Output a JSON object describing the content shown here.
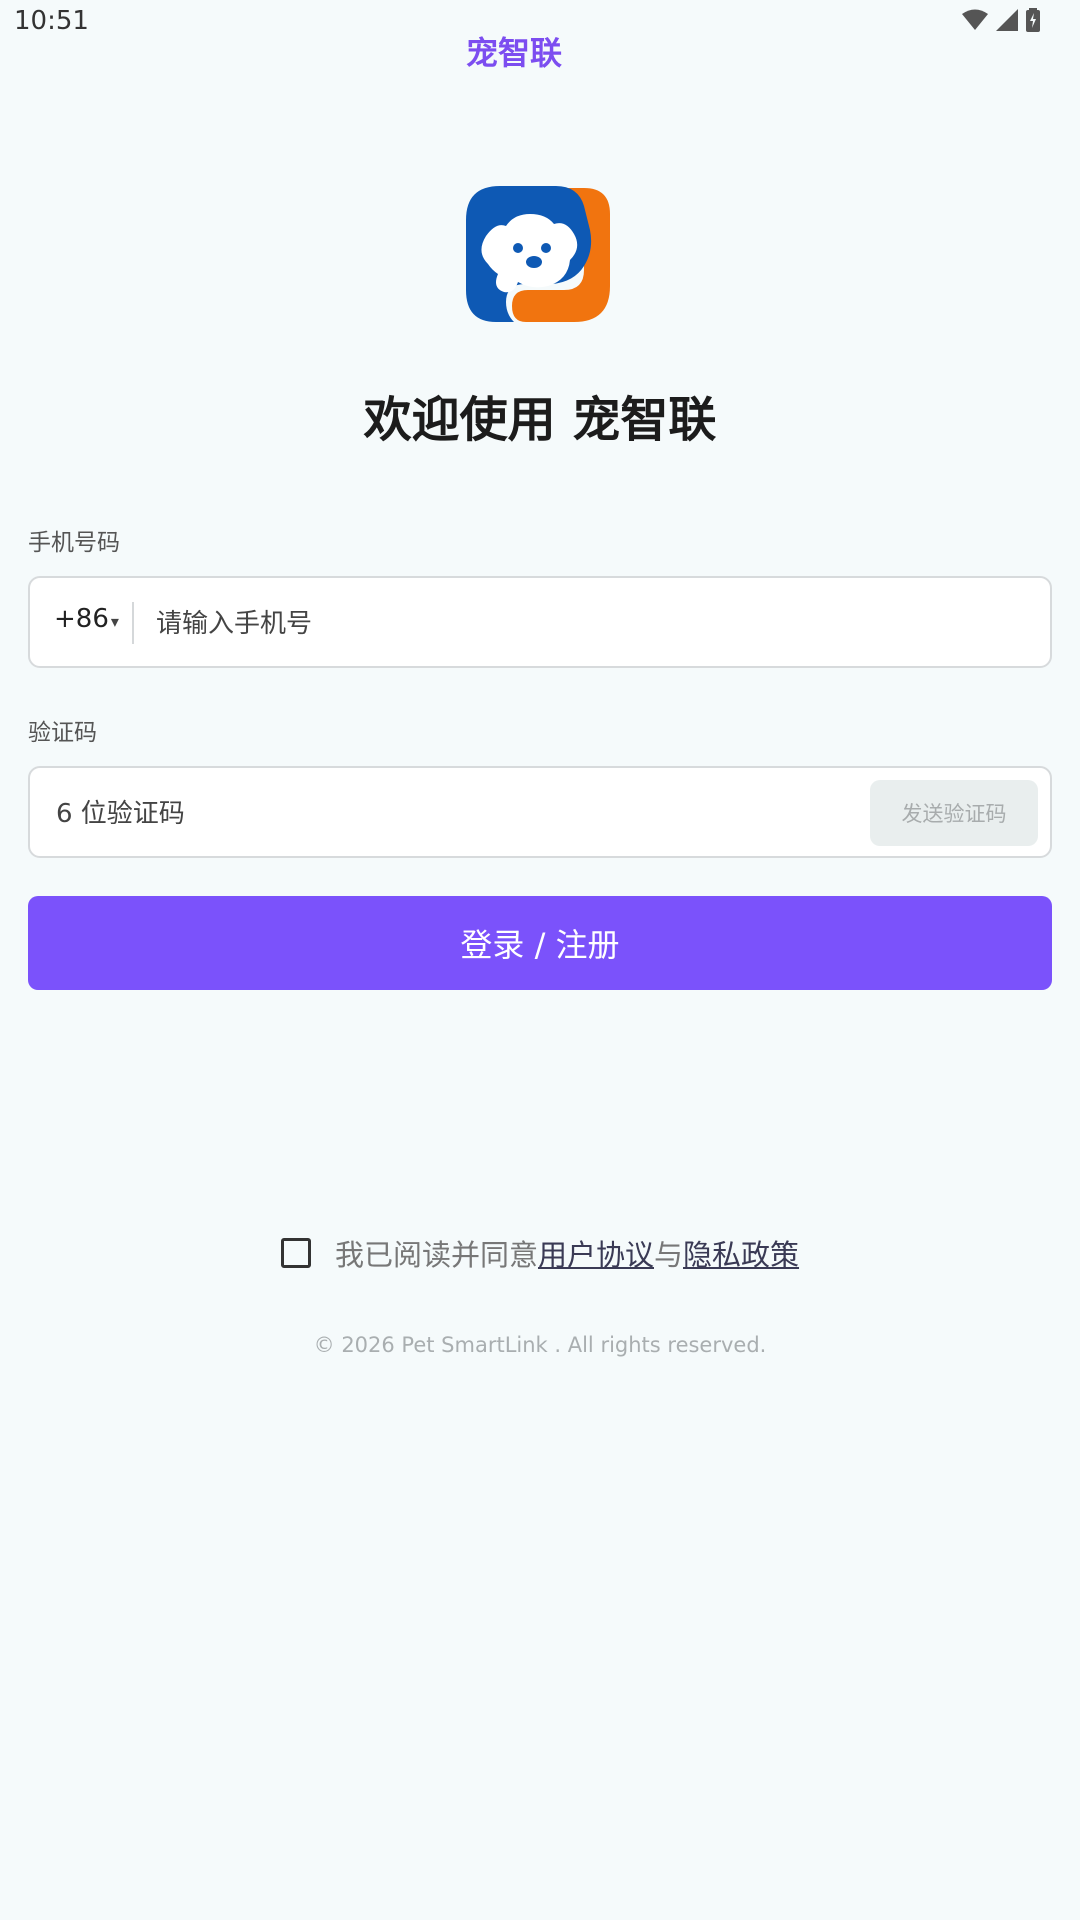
{
  "status_bar": {
    "time": "10:51"
  },
  "app_bar": {
    "title": "宠智联",
    "title_color": "#7c4df0"
  },
  "logo": {
    "icon": "dog-face-logo-icon",
    "colors": {
      "blue": "#0e59b4",
      "orange": "#f1740f"
    }
  },
  "welcome": "欢迎使用 宠智联",
  "phone": {
    "label": "手机号码",
    "country_code": "+86",
    "placeholder": "请输入手机号",
    "value": ""
  },
  "code": {
    "label": "验证码",
    "placeholder": "6 位验证码",
    "value": "",
    "send_label": "发送验证码"
  },
  "login_button": {
    "label": "登录 / 注册",
    "color": "#7b52fb"
  },
  "agreement": {
    "checked": false,
    "prefix": "我已阅读并同意",
    "user_agreement": "用户协议",
    "and": "与",
    "privacy_policy": "隐私政策"
  },
  "copyright": "© 2026 Pet SmartLink . All rights reserved."
}
